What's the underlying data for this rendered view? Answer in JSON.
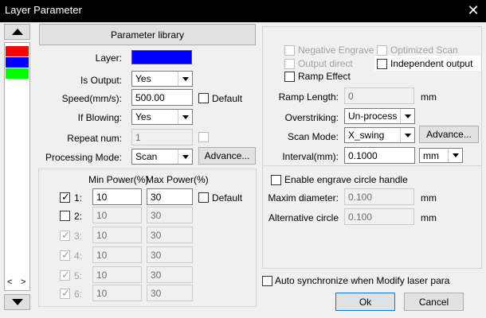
{
  "window": {
    "title": "Layer Parameter",
    "close_glyph": "✕"
  },
  "layer_list": {
    "colors": [
      "#ff0000",
      "#0000ff",
      "#00ff00"
    ],
    "scroll_left": "<",
    "scroll_right": ">"
  },
  "left": {
    "param_library_label": "Parameter library",
    "layer_label": "Layer:",
    "layer_color": "#0000ff",
    "is_output_label": "Is Output:",
    "is_output_value": "Yes",
    "speed_label": "Speed(mm/s):",
    "speed_value": "500.00",
    "default_label": "Default",
    "if_blowing_label": "If Blowing:",
    "if_blowing_value": "Yes",
    "repeat_label": "Repeat num:",
    "repeat_value": "1",
    "processing_mode_label": "Processing Mode:",
    "processing_mode_value": "Scan",
    "advance_label": "Advance..."
  },
  "power": {
    "min_header": "Min Power(%)",
    "max_header": "Max Power(%)",
    "default_label": "Default",
    "rows": [
      {
        "num": "1:",
        "min": "10",
        "max": "30"
      },
      {
        "num": "2:",
        "min": "10",
        "max": "30"
      },
      {
        "num": "3:",
        "min": "10",
        "max": "30"
      },
      {
        "num": "4:",
        "min": "10",
        "max": "30"
      },
      {
        "num": "5:",
        "min": "10",
        "max": "30"
      },
      {
        "num": "6:",
        "min": "10",
        "max": "30"
      }
    ]
  },
  "right": {
    "negative_engrave": "Negative Engrave",
    "optimized_scan": "Optimized Scan",
    "output_direct": "Output direct",
    "independent_output": "Independent output",
    "ramp_effect": "Ramp Effect",
    "ramp_length_label": "Ramp Length:",
    "ramp_length_value": "0",
    "mm": "mm",
    "overstriking_label": "Overstriking:",
    "overstriking_value": "Un-process",
    "scan_mode_label": "Scan Mode:",
    "scan_mode_value": "X_swing",
    "advance_label": "Advance...",
    "interval_label": "Interval(mm):",
    "interval_value": "0.1000",
    "interval_unit": "mm",
    "engrave_circle_label": "Enable engrave circle handle",
    "maxim_diameter_label": "Maxim diameter:",
    "maxim_diameter_value": "0.100",
    "alt_circle_label": "Alternative circle",
    "alt_circle_value": "0.100"
  },
  "footer": {
    "auto_sync_label": "Auto synchronize when Modify laser para",
    "ok_label": "Ok",
    "cancel_label": "Cancel"
  }
}
